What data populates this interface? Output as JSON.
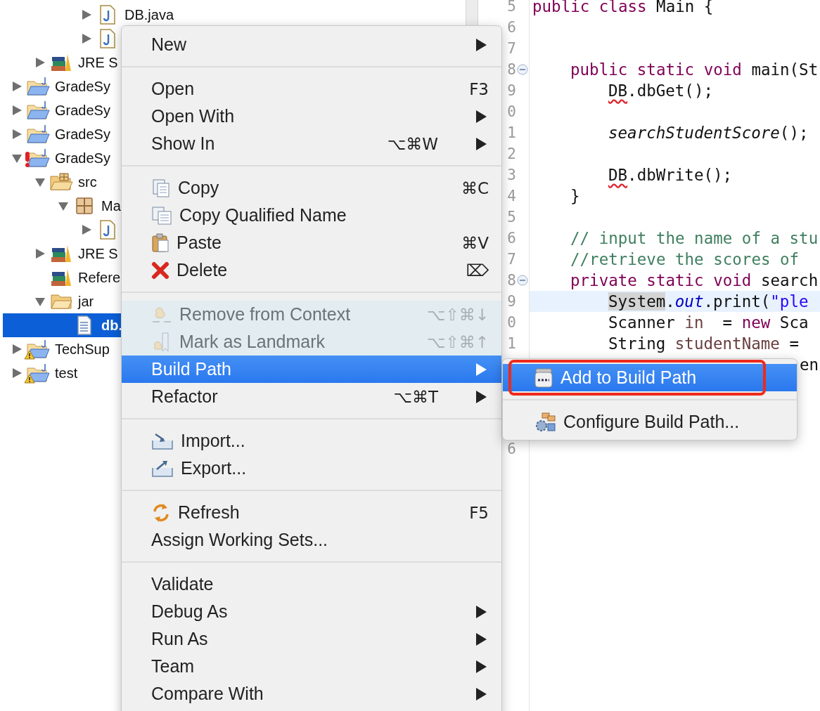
{
  "project_tree": [
    {
      "kind": "offscreen",
      "children": [
        {
          "kind": "offscreen",
          "children": [
            {
              "kind": "offscreen",
              "children": [
                {
                  "kind": "java-file",
                  "label": "DB.java",
                  "expanded": false,
                  "selected": false
                },
                {
                  "kind": "java-file",
                  "expanded": false,
                  "selected": false
                }
              ]
            }
          ]
        },
        {
          "kind": "library",
          "label": "JRE S",
          "expanded": false,
          "selected": false
        }
      ]
    },
    {
      "kind": "project",
      "label": "GradeSy",
      "expanded": false,
      "selected": false,
      "error": false,
      "warning": false
    },
    {
      "kind": "project",
      "label": "GradeSy",
      "expanded": false,
      "selected": false,
      "error": false,
      "warning": false
    },
    {
      "kind": "project",
      "label": "GradeSy",
      "expanded": false,
      "selected": false,
      "error": false,
      "warning": false
    },
    {
      "kind": "project",
      "label": "GradeSy",
      "expanded": true,
      "selected": false,
      "error": true,
      "warning": false,
      "children": [
        {
          "kind": "source-folder",
          "label": "src",
          "expanded": true,
          "selected": false,
          "children": [
            {
              "kind": "package",
              "label": "Ma",
              "expanded": true,
              "selected": false,
              "children": [
                {
                  "kind": "java-file",
                  "expanded": false,
                  "selected": false
                }
              ]
            }
          ]
        },
        {
          "kind": "library",
          "label": "JRE S",
          "expanded": false,
          "selected": false
        },
        {
          "kind": "library",
          "label": "Refere",
          "selected": false
        },
        {
          "kind": "folder",
          "label": "jar",
          "expanded": true,
          "selected": false,
          "children": [
            {
              "kind": "text-file",
              "label": "db.",
              "selected": true
            }
          ]
        }
      ]
    },
    {
      "kind": "project",
      "label": "TechSup",
      "expanded": false,
      "selected": false,
      "error": false,
      "warning": true
    },
    {
      "kind": "project",
      "label": "test",
      "expanded": false,
      "selected": false,
      "error": false,
      "warning": true
    }
  ],
  "editor": {
    "lines": [
      {
        "number": "5",
        "kind": "top",
        "code": [
          {
            "kind": "keyword",
            "text": "public class"
          },
          {
            "kind": "plain",
            "text": " Main {"
          }
        ]
      },
      {
        "number": "6"
      },
      {
        "number": "7"
      },
      {
        "number": "8",
        "fold": true,
        "kind": "member",
        "code": [
          {
            "kind": "keyword",
            "text": "public static void"
          },
          {
            "kind": "plain",
            "text": " main(St"
          }
        ]
      },
      {
        "number": "9",
        "kind": "statement",
        "code": [
          {
            "kind": "error",
            "text": "DB"
          },
          {
            "kind": "plain",
            "text": ".dbGet();"
          }
        ]
      },
      {
        "number": "0"
      },
      {
        "number": "1",
        "kind": "statement",
        "code": [
          {
            "kind": "static-call",
            "text": "searchStudentScore"
          },
          {
            "kind": "plain",
            "text": "();"
          }
        ]
      },
      {
        "number": "2"
      },
      {
        "number": "3",
        "kind": "statement",
        "code": [
          {
            "kind": "error",
            "text": "DB"
          },
          {
            "kind": "plain",
            "text": ".dbWrite();"
          }
        ]
      },
      {
        "number": "4",
        "kind": "member",
        "code": [
          {
            "kind": "plain",
            "text": "}"
          }
        ]
      },
      {
        "number": "5"
      },
      {
        "number": "6",
        "kind": "member",
        "code": [
          {
            "kind": "comment",
            "text": "// input the name of a stu"
          }
        ]
      },
      {
        "number": "7",
        "kind": "member",
        "code": [
          {
            "kind": "comment",
            "text": "//retrieve the scores of"
          }
        ]
      },
      {
        "number": "8",
        "fold": true,
        "kind": "member",
        "code": [
          {
            "kind": "keyword",
            "text": "private static void"
          },
          {
            "kind": "plain",
            "text": " search"
          }
        ]
      },
      {
        "number": "9",
        "current": true,
        "kind": "statement",
        "code": [
          {
            "kind": "occurrence",
            "text": "System"
          },
          {
            "kind": "plain",
            "text": "."
          },
          {
            "kind": "field",
            "text": "out"
          },
          {
            "kind": "plain",
            "text": ".print("
          },
          {
            "kind": "string",
            "text": "\"ple"
          }
        ]
      },
      {
        "number": "0",
        "kind": "statement",
        "code": [
          {
            "kind": "plain",
            "text": "Scanner "
          },
          {
            "kind": "local",
            "text": "in"
          },
          {
            "kind": "plain",
            "text": "  = "
          },
          {
            "kind": "keyword",
            "text": "new"
          },
          {
            "kind": "plain",
            "text": " Sca"
          }
        ]
      },
      {
        "number": "1",
        "kind": "statement",
        "code": [
          {
            "kind": "plain",
            "text": "String "
          },
          {
            "kind": "local",
            "text": "studentName"
          },
          {
            "kind": "plain",
            "text": " ="
          }
        ]
      },
      {
        "kind": "tail",
        "code": [
          {
            "kind": "plain",
            "text": "en"
          }
        ]
      },
      {
        "number": "6",
        "kind": "resumed"
      }
    ]
  },
  "context_menu": {
    "groups": [
      [
        {
          "kind": "plain",
          "label": "New",
          "submenu": true,
          "disabled": false,
          "selected": false
        }
      ],
      [
        {
          "kind": "plain",
          "label": "Open",
          "shortcut": "F3",
          "disabled": false,
          "selected": false
        },
        {
          "kind": "plain",
          "label": "Open With",
          "submenu": true,
          "disabled": false,
          "selected": false
        },
        {
          "kind": "plain",
          "label": "Show In",
          "shortcut": "⌥⌘W",
          "submenu": true,
          "disabled": false,
          "selected": false
        }
      ],
      [
        {
          "kind": "copy",
          "label": "Copy",
          "shortcut": "⌘C",
          "disabled": false,
          "selected": false
        },
        {
          "kind": "copy-name",
          "label": "Copy Qualified Name",
          "disabled": false,
          "selected": false
        },
        {
          "kind": "paste",
          "label": "Paste",
          "shortcut": "⌘V",
          "disabled": false,
          "selected": false
        },
        {
          "kind": "delete",
          "label": "Delete",
          "shortcut": "⌦",
          "disabled": false,
          "selected": false
        }
      ],
      [
        {
          "kind": "remove-context",
          "label": "Remove from Context",
          "shortcut": "⌥⇧⌘↓",
          "disabled": true,
          "selected": false
        },
        {
          "kind": "landmark",
          "label": "Mark as Landmark",
          "shortcut": "⌥⇧⌘↑",
          "disabled": true,
          "selected": false
        },
        {
          "kind": "plain",
          "label": "Build Path",
          "submenu": true,
          "disabled": false,
          "selected": true
        },
        {
          "kind": "plain",
          "label": "Refactor",
          "shortcut": "⌥⌘T",
          "submenu": true,
          "disabled": false,
          "selected": false
        }
      ],
      [
        {
          "kind": "import",
          "label": "Import...",
          "disabled": false,
          "selected": false
        },
        {
          "kind": "export",
          "label": "Export...",
          "disabled": false,
          "selected": false
        }
      ],
      [
        {
          "kind": "refresh",
          "label": "Refresh",
          "shortcut": "F5",
          "disabled": false,
          "selected": false
        },
        {
          "kind": "plain",
          "label": "Assign Working Sets...",
          "disabled": false,
          "selected": false
        }
      ],
      [
        {
          "kind": "plain",
          "label": "Validate",
          "disabled": false,
          "selected": false
        },
        {
          "kind": "plain",
          "label": "Debug As",
          "submenu": true,
          "disabled": false,
          "selected": false
        },
        {
          "kind": "plain",
          "label": "Run As",
          "submenu": true,
          "disabled": false,
          "selected": false
        },
        {
          "kind": "plain",
          "label": "Team",
          "submenu": true,
          "disabled": false,
          "selected": false
        },
        {
          "kind": "plain",
          "label": "Compare With",
          "submenu": true,
          "disabled": false,
          "selected": false
        }
      ]
    ]
  },
  "build_path_submenu": {
    "groups": [
      [
        {
          "kind": "jar",
          "label": "Add to Build Path",
          "selected": true,
          "highlighted": true
        }
      ],
      [
        {
          "kind": "configure",
          "label": "Configure Build Path...",
          "selected": false,
          "highlighted": false
        }
      ]
    ]
  }
}
